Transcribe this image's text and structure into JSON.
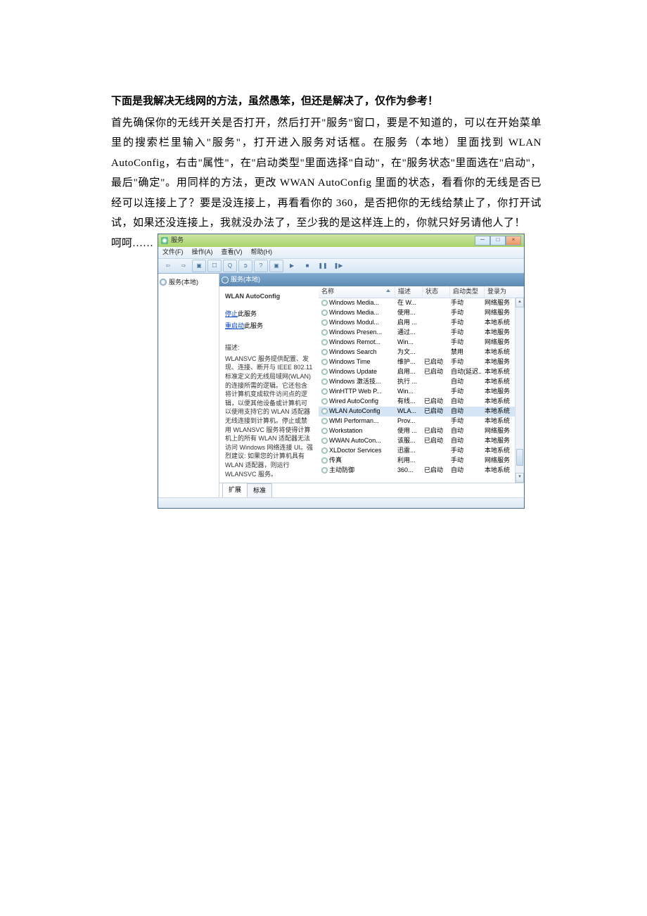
{
  "doc": {
    "title": "下面是我解决无线网的方法，虽然愚笨，但还是解决了，仅作为参考！",
    "body": "首先确保你的无线开关是否打开，然后打开\"服务\"窗口，要是不知道的，可以在开始菜单里的搜索栏里输入\"服务\"，打开进入服务对话框。在服务（本地）里面找到 WLAN AutoConfig，右击\"属性\"，在\"启动类型\"里面选择\"自动\"，在\"服务状态\"里面选在\"启动\"，最后\"确定\"。用同样的方法，更改 WWAN AutoConfig 里面的状态，看看你的无线是否已经可以连接上了？要是没连接上，再看看你的 360，是否把你的无线给禁止了，你打开试试，如果还没连接上，我就没办法了，至少我的是这样连上的，你就只好另请他人了！",
    "closing": "呵呵……"
  },
  "win": {
    "title": "服务",
    "menus": [
      "文件(F)",
      "操作(A)",
      "查看(V)",
      "帮助(H)"
    ],
    "tree": "服务(本地)",
    "rheader": "服务(本地)",
    "selected": {
      "name": "WLAN AutoConfig",
      "stop": "停止",
      "restart": "重启动",
      "this_service": "此服务",
      "desc_label": "描述:",
      "desc": "WLANSVC 服务提供配置、发现、连接、断开与 IEEE 802.11 标准定义的无线局域网(WLAN)的连接所需的逻辑。它还包含将计算机变成软件访问点的逻辑，以便其他设备或计算机可以使用支持它的 WLAN 适配器无线连接到计算机。停止或禁用 WLANSVC 服务将使得计算机上的所有 WLAN 适配器无法访问 Windows 网络连接 UI。强烈建议: 如果您的计算机具有 WLAN 适配器，则运行 WLANSVC 服务。"
    },
    "columns": {
      "name": "名称",
      "desc": "描述",
      "status": "状态",
      "startup": "启动类型",
      "logon": "登录为"
    },
    "rows": [
      {
        "n": "Windows Media...",
        "d": "在 W...",
        "s": "",
        "t": "手动",
        "l": "网络服务"
      },
      {
        "n": "Windows Media...",
        "d": "使用...",
        "s": "",
        "t": "手动",
        "l": "网络服务"
      },
      {
        "n": "Windows Modul...",
        "d": "启用 ...",
        "s": "",
        "t": "手动",
        "l": "本地系统"
      },
      {
        "n": "Windows Presen...",
        "d": "通过...",
        "s": "",
        "t": "手动",
        "l": "本地服务"
      },
      {
        "n": "Windows Remot...",
        "d": "Win...",
        "s": "",
        "t": "手动",
        "l": "网络服务"
      },
      {
        "n": "Windows Search",
        "d": "为文...",
        "s": "",
        "t": "禁用",
        "l": "本地系统"
      },
      {
        "n": "Windows Time",
        "d": "维护...",
        "s": "已启动",
        "t": "手动",
        "l": "本地服务"
      },
      {
        "n": "Windows Update",
        "d": "启用...",
        "s": "已启动",
        "t": "自动(延迟...",
        "l": "本地系统"
      },
      {
        "n": "Windows 激活技...",
        "d": "执行 ...",
        "s": "",
        "t": "自动",
        "l": "本地系统"
      },
      {
        "n": "WinHTTP Web P...",
        "d": "Win...",
        "s": "",
        "t": "手动",
        "l": "本地服务"
      },
      {
        "n": "Wired AutoConfig",
        "d": "有线...",
        "s": "已启动",
        "t": "自动",
        "l": "本地系统"
      },
      {
        "n": "WLAN AutoConfig",
        "d": "WLA...",
        "s": "已启动",
        "t": "自动",
        "l": "本地系统",
        "sel": true
      },
      {
        "n": "WMI Performan...",
        "d": "Prov...",
        "s": "",
        "t": "手动",
        "l": "本地系统"
      },
      {
        "n": "Workstation",
        "d": "使用 ...",
        "s": "已启动",
        "t": "自动",
        "l": "网络服务"
      },
      {
        "n": "WWAN AutoCon...",
        "d": "该服...",
        "s": "已启动",
        "t": "自动",
        "l": "本地服务"
      },
      {
        "n": "XLDoctor Services",
        "d": "迅雷...",
        "s": "",
        "t": "手动",
        "l": "本地系统"
      },
      {
        "n": "传真",
        "d": "利用...",
        "s": "",
        "t": "手动",
        "l": "网络服务"
      },
      {
        "n": "主动防御",
        "d": "360...",
        "s": "已启动",
        "t": "自动",
        "l": "本地系统"
      }
    ],
    "tabs": {
      "ext": "扩展",
      "std": "标准"
    }
  }
}
